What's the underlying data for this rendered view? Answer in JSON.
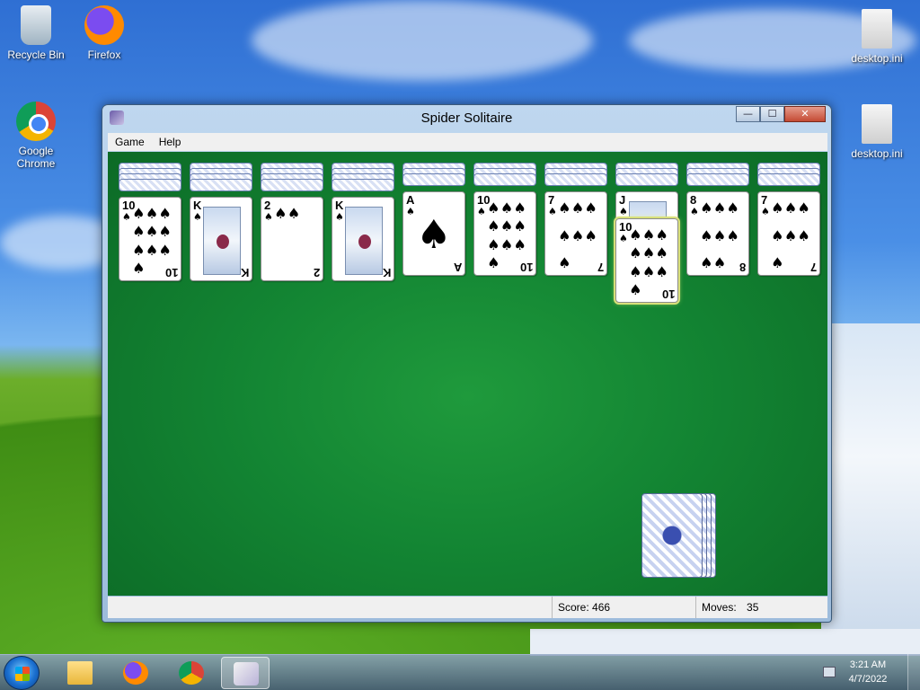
{
  "desktop": {
    "icons": [
      {
        "label": "Recycle Bin"
      },
      {
        "label": "Firefox"
      },
      {
        "label": "Google Chrome"
      },
      {
        "label": "desktop.ini"
      },
      {
        "label": "desktop.ini"
      }
    ]
  },
  "window": {
    "title": "Spider Solitaire",
    "buttons": {
      "minimize": "—",
      "maximize": "☐",
      "close": "✕"
    }
  },
  "menu": {
    "game": "Game",
    "help": "Help"
  },
  "tableau": [
    {
      "hidden": 4,
      "cards": [
        {
          "rank": "10",
          "suit": "♠"
        }
      ]
    },
    {
      "hidden": 4,
      "cards": [
        {
          "rank": "K",
          "suit": "♠"
        }
      ]
    },
    {
      "hidden": 4,
      "cards": [
        {
          "rank": "2",
          "suit": "♠"
        }
      ]
    },
    {
      "hidden": 4,
      "cards": [
        {
          "rank": "K",
          "suit": "♠"
        }
      ]
    },
    {
      "hidden": 3,
      "cards": [
        {
          "rank": "A",
          "suit": "♠"
        }
      ]
    },
    {
      "hidden": 3,
      "cards": [
        {
          "rank": "10",
          "suit": "♠"
        }
      ]
    },
    {
      "hidden": 3,
      "cards": [
        {
          "rank": "7",
          "suit": "♠"
        }
      ]
    },
    {
      "hidden": 3,
      "cards": [
        {
          "rank": "J",
          "suit": "♠"
        },
        {
          "rank": "10",
          "suit": "♠",
          "selected": true
        }
      ]
    },
    {
      "hidden": 3,
      "cards": [
        {
          "rank": "8",
          "suit": "♠"
        }
      ]
    },
    {
      "hidden": 3,
      "cards": [
        {
          "rank": "7",
          "suit": "♠"
        }
      ]
    }
  ],
  "stock": {
    "remaining_deals": 4
  },
  "status": {
    "score": "Score: 466",
    "moves_label": "Moves:",
    "moves": "35"
  },
  "taskbar": {
    "items": [
      "file-explorer",
      "firefox",
      "chrome",
      "spider-solitaire"
    ],
    "clock_time": "3:21 AM",
    "clock_date": "4/7/2022"
  }
}
